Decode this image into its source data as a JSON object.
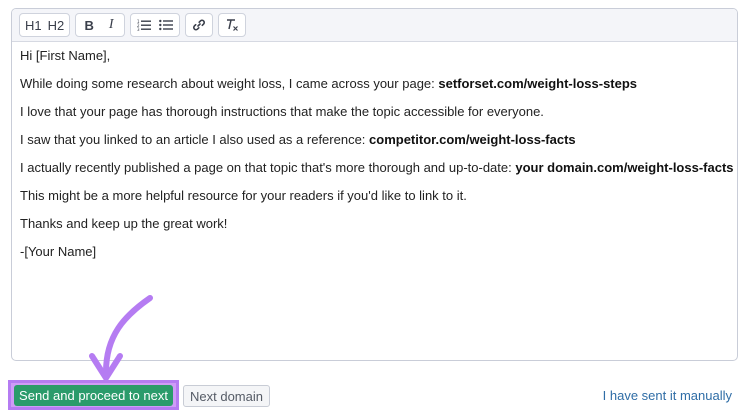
{
  "editor": {
    "toolbar": {
      "h1_label": "H1",
      "h2_label": "H2",
      "bold_label": "B",
      "italic_label": "I",
      "icons": [
        "heading-1-icon",
        "heading-2-icon",
        "bold-icon",
        "italic-icon",
        "ordered-list-icon",
        "bullet-list-icon",
        "link-icon",
        "clear-format-icon"
      ]
    },
    "lines": [
      {
        "text": "Hi [First Name],",
        "bold": ""
      },
      {
        "text": "While doing some research about weight loss, I came across your page: ",
        "bold": "setforset.com/weight-loss-steps"
      },
      {
        "text": "I love that your page has thorough instructions that make the topic accessible for everyone.",
        "bold": ""
      },
      {
        "text": "I saw that you linked to an article I also used as a reference: ",
        "bold": "competitor.com/weight-loss-facts"
      },
      {
        "text": "I actually recently published a page on that topic that's more thorough and up-to-date: ",
        "bold": "your domain.com/weight-loss-facts"
      },
      {
        "text": "This might be a more helpful resource for your readers if you'd like to link to it.",
        "bold": ""
      },
      {
        "text": "Thanks and keep up the great work!",
        "bold": ""
      },
      {
        "text": "-[Your Name]",
        "bold": ""
      }
    ]
  },
  "footer": {
    "send_label": "Send and proceed to next",
    "next_label": "Next domain",
    "manual_label": "I have sent it manually"
  },
  "colors": {
    "send_button": "#2b9b6b",
    "highlight": "#b57cf2",
    "link": "#2f6da6"
  }
}
